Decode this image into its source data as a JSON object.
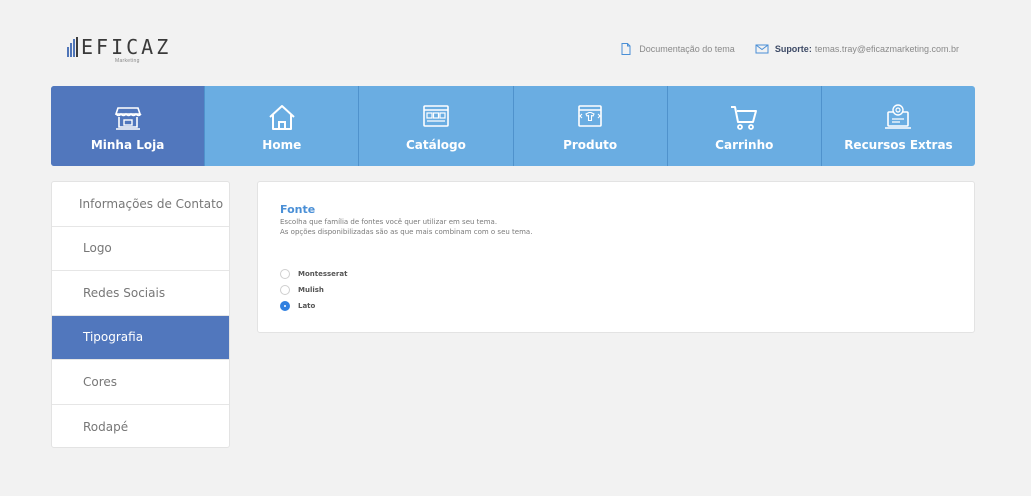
{
  "brand": {
    "name": "EFICAZ",
    "tagline": "Marketing",
    "color": "#4f75b8"
  },
  "header": {
    "docs_label": "Documentação do tema",
    "support_label": "Suporte:",
    "support_email": "temas.tray@eficazmarketing.com.br"
  },
  "nav": {
    "items": [
      {
        "label": "Minha Loja",
        "icon": "store-icon",
        "active": true
      },
      {
        "label": "Home",
        "icon": "home-icon",
        "active": false
      },
      {
        "label": "Catálogo",
        "icon": "catalog-icon",
        "active": false
      },
      {
        "label": "Produto",
        "icon": "product-icon",
        "active": false
      },
      {
        "label": "Carrinho",
        "icon": "cart-icon",
        "active": false
      },
      {
        "label": "Recursos Extras",
        "icon": "extras-icon",
        "active": false
      }
    ],
    "colors": {
      "base": "#6aade2",
      "active": "#5177bd"
    }
  },
  "sidebar": {
    "items": [
      {
        "label": "Informações de Contato",
        "active": false
      },
      {
        "label": "Logo",
        "active": false
      },
      {
        "label": "Redes Sociais",
        "active": false
      },
      {
        "label": "Tipografia",
        "active": true
      },
      {
        "label": "Cores",
        "active": false
      },
      {
        "label": "Rodapé",
        "active": false
      }
    ]
  },
  "content": {
    "title": "Fonte",
    "description_line1": "Escolha que família de fontes você quer utilizar em seu tema.",
    "description_line2": "As opções disponibilizadas são as que mais combinam com o seu tema.",
    "options": [
      {
        "label": "Montesserat",
        "checked": false
      },
      {
        "label": "Mulish",
        "checked": false
      },
      {
        "label": "Lato",
        "checked": true
      }
    ],
    "accent_color": "#2f7fe0"
  }
}
